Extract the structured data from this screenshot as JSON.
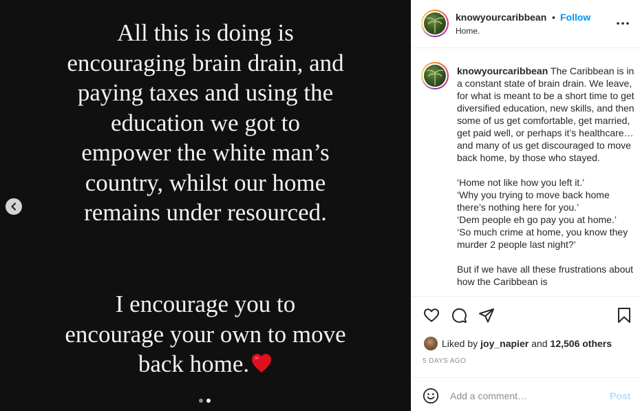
{
  "media": {
    "top_lines": [
      "All this is doing is",
      "encouraging brain drain, and",
      "paying taxes and using the",
      "education we got to",
      "empower the white man’s",
      "country, whilst our home",
      "remains under resourced."
    ],
    "bottom_lines": [
      "I encourage you to",
      "encourage your own to move",
      "back home."
    ],
    "carousel": {
      "count": 2,
      "active_index": 1
    }
  },
  "header": {
    "username": "knowyourcaribbean",
    "separator": "•",
    "follow_label": "Follow",
    "subtitle": "Home."
  },
  "caption": {
    "username": "knowyourcaribbean",
    "paragraphs": [
      "The Caribbean is in a constant state of brain drain. We leave, for what is meant to be a short time to get diversified education, new skills, and then some of us get comfortable, get married, get paid well, or perhaps it’s healthcare…and many of us get discouraged to move back home, by those who stayed.",
      "‘Home not like how you left it.’",
      "‘Why you trying to move back home there’s nothing here for you.’",
      "‘Dem people eh go pay you at home.’",
      "‘So much crime at home, you know they murder 2 people last night?’",
      "But if we have all these frustrations about how the Caribbean is"
    ]
  },
  "likes": {
    "prefix": "Liked by",
    "user": "joy_napier",
    "joiner": "and",
    "others": "12,506 others"
  },
  "timestamp": "5 DAYS AGO",
  "comment": {
    "placeholder": "Add a comment…",
    "post_label": "Post"
  },
  "colors": {
    "follow": "#0095f6",
    "post_disabled": "#b2dffc",
    "media_bg": "#101010"
  }
}
